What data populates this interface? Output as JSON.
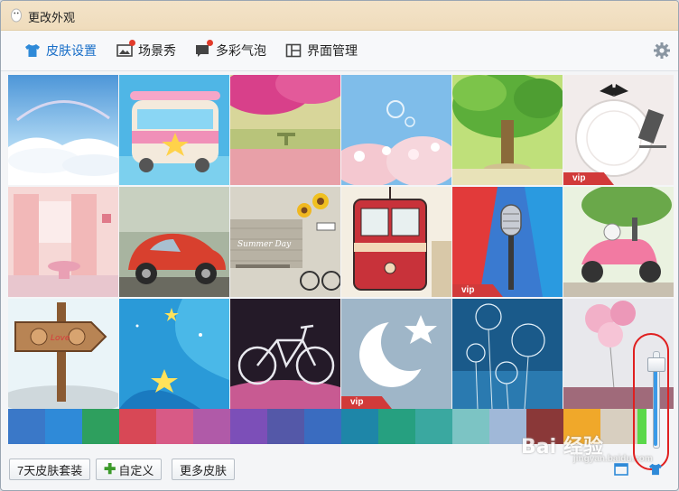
{
  "window": {
    "title": "更改外观"
  },
  "tabs": [
    {
      "label": "皮肤设置",
      "icon": "tshirt-icon",
      "active": true
    },
    {
      "label": "场景秀",
      "icon": "picture-icon"
    },
    {
      "label": "多彩气泡",
      "icon": "chat-bubble-icon"
    },
    {
      "label": "界面管理",
      "icon": "layout-icon"
    }
  ],
  "skins": [
    {
      "name": "sky-clouds",
      "vip": false
    },
    {
      "name": "ice-cream-bus",
      "vip": false
    },
    {
      "name": "pink-blossom-tree",
      "vip": false
    },
    {
      "name": "cherry-blossom-sky",
      "vip": false
    },
    {
      "name": "green-tree",
      "vip": false
    },
    {
      "name": "plate-cutlery",
      "vip": true
    },
    {
      "name": "pink-room",
      "vip": false
    },
    {
      "name": "red-beetle-car",
      "vip": false
    },
    {
      "name": "sunflower-street",
      "vip": false
    },
    {
      "name": "red-tram",
      "vip": false
    },
    {
      "name": "microphone",
      "vip": true
    },
    {
      "name": "pink-scooter",
      "vip": false
    },
    {
      "name": "wooden-sign",
      "vip": false
    },
    {
      "name": "blue-stars",
      "vip": false
    },
    {
      "name": "bicycle",
      "vip": false
    },
    {
      "name": "moon-star",
      "vip": true
    },
    {
      "name": "dandelion",
      "vip": false
    },
    {
      "name": "pink-balloons",
      "vip": false
    }
  ],
  "vip_label": "vip",
  "sign_text": "Love",
  "street_text": "Summer Day",
  "swatches": [
    "#3a78c8",
    "#2f8ad8",
    "#2e9f5e",
    "#d84856",
    "#d85a86",
    "#b05aa8",
    "#7c4fb8",
    "#5458a8",
    "#3a6cc0",
    "#1e86a8",
    "#26a080",
    "#3aa8a0",
    "#7cc4c4",
    "#a0b8d8",
    "#8a3838",
    "#f0a82a",
    "#d8cfc0",
    "#5ad84a"
  ],
  "slider": {
    "value": 0.9
  },
  "buttons": {
    "trial": "7天皮肤套装",
    "custom": "自定义",
    "more": "更多皮肤"
  },
  "watermark": {
    "brand": "Bai 经验",
    "url": "jingyan.baidu.com"
  }
}
